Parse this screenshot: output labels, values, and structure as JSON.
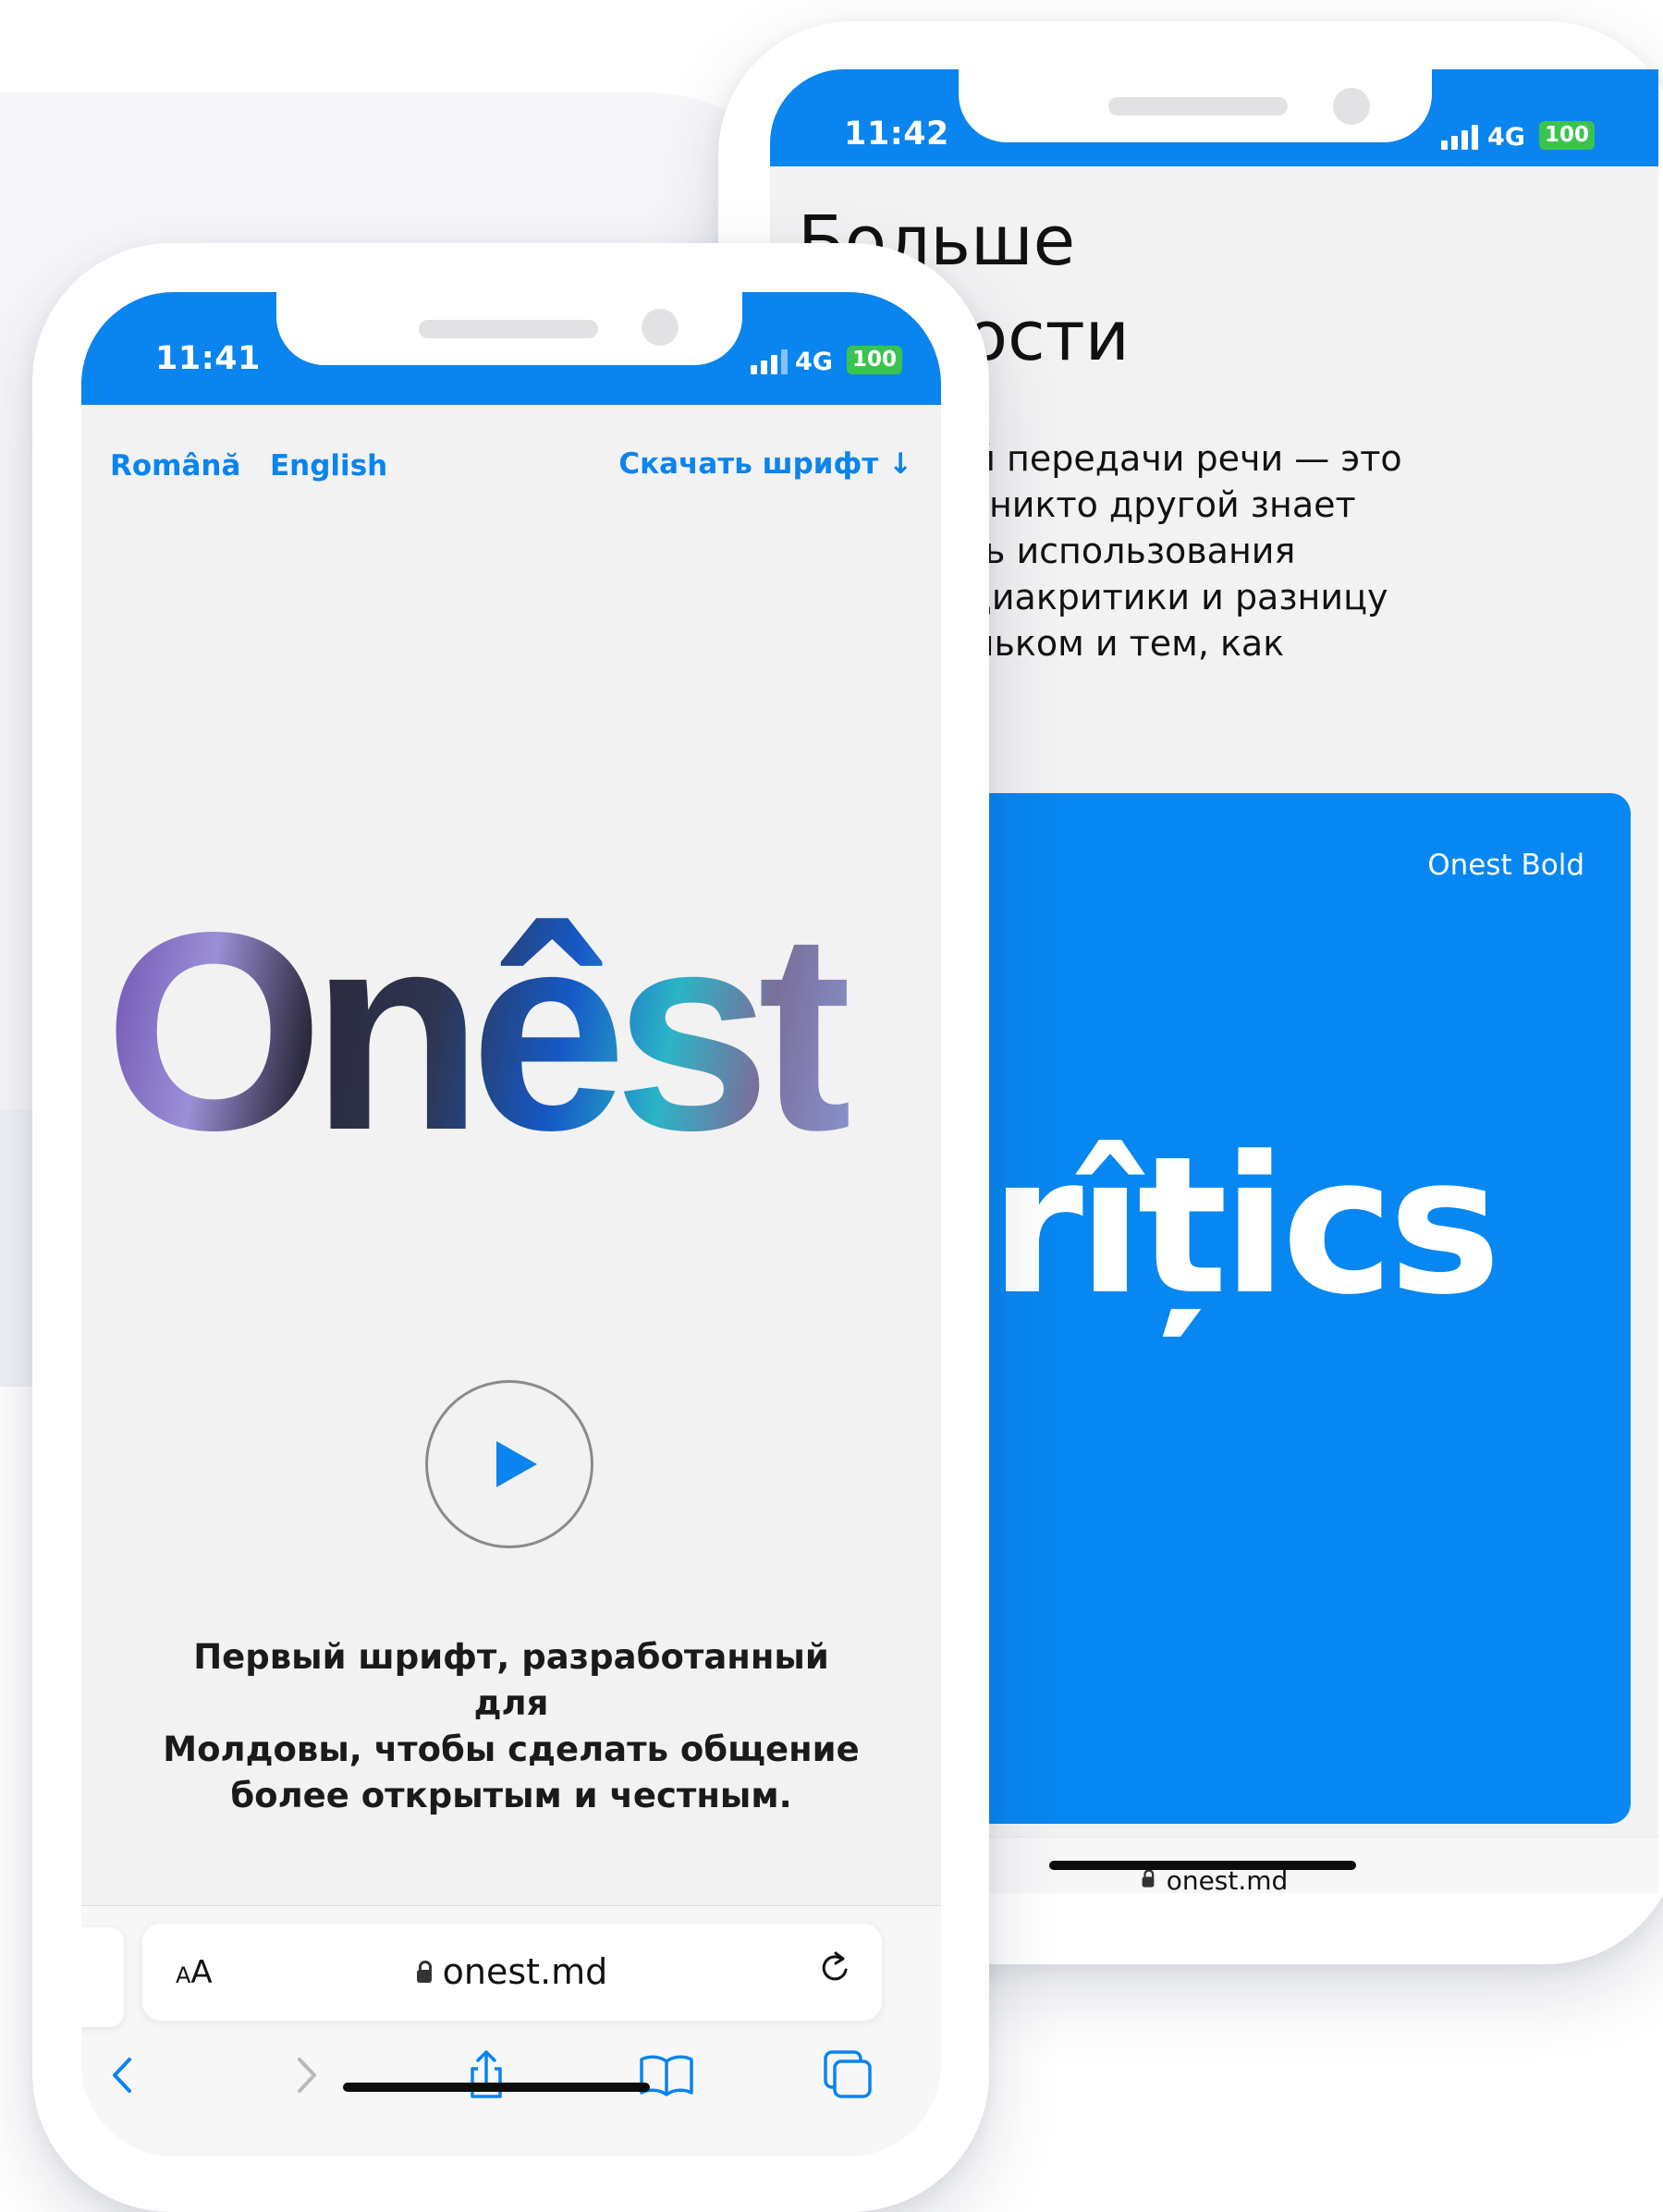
{
  "back_phone": {
    "status": {
      "time": "11:42",
      "network": "4G",
      "battery": "100"
    },
    "heading": "Больше\nектности",
    "paragraph": "равильной передачи речи — это\nst. Он как никто другой знает\nи ценность использования\nх знаков диакритики и разницу\nилей, огоньком и тем, как\nть.",
    "card": {
      "label": "Onest Bold",
      "word": "ăçrîțics",
      "color": "#0787f2"
    },
    "url": "onest.md"
  },
  "front_phone": {
    "status": {
      "time": "11:41",
      "network": "4G",
      "battery": "100"
    },
    "nav": {
      "lang_ro": "Română",
      "lang_en": "English",
      "download": "Скачать шрифт ↓"
    },
    "logo": "Onêst",
    "tagline": "Первый шрифт, разработанный для\nМолдовы, чтобы сделать общение\nболее открытым и честным.",
    "browser": {
      "text_size_label": "AA",
      "url": "onest.md"
    }
  },
  "colors": {
    "accent": "#0a84ee",
    "battery": "#3ac44e",
    "background": "#f2f2f3"
  },
  "icons": [
    "play-icon",
    "lock-icon",
    "reload-icon",
    "back-icon",
    "forward-icon",
    "share-icon",
    "bookmarks-icon",
    "tabs-icon"
  ]
}
